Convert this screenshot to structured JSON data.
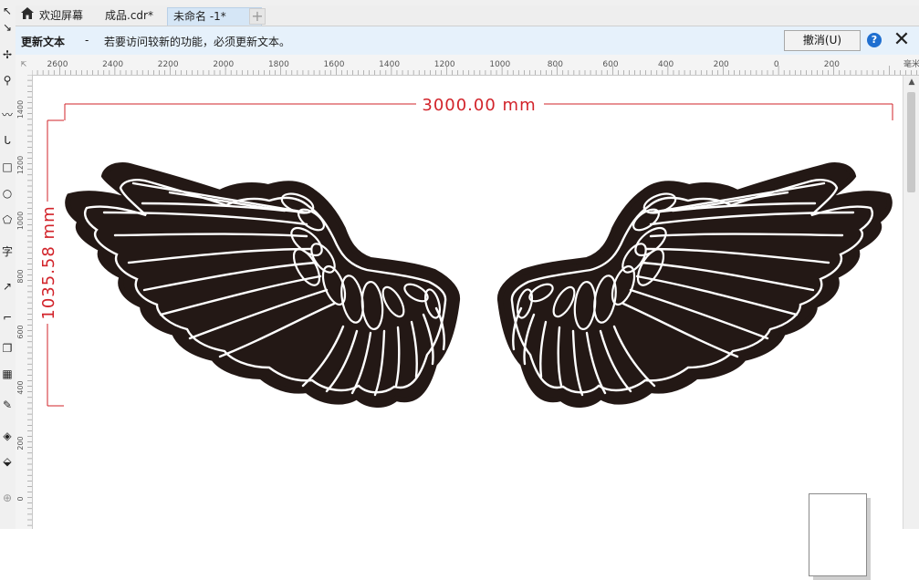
{
  "tabs": {
    "home_label": "欢迎屏幕",
    "file_label": "成品.cdr*",
    "active_label": "未命名 -1*",
    "add_label": "+"
  },
  "notification": {
    "title": "更新文本",
    "dash": "-",
    "message": "若要访问较新的功能，必须更新文本。",
    "cancel_label": "撤消(U)",
    "help_label": "?",
    "close_label": "✕"
  },
  "ruler": {
    "corner_label": "⇱",
    "unit": "毫米",
    "h_ticks": [
      "2600",
      "2400",
      "2200",
      "2000",
      "1800",
      "1600",
      "1400",
      "1200",
      "1000",
      "800",
      "600",
      "400",
      "200",
      "0",
      "200"
    ],
    "v_ticks": [
      "1400",
      "1200",
      "1000",
      "800",
      "600",
      "400",
      "200",
      "0"
    ]
  },
  "dimensions": {
    "width_label": "3000.00 mm",
    "height_label": "1035.58 mm",
    "color": "#d2232a"
  },
  "toolbox": {
    "icons": [
      "pick-tool-icon",
      "shape-tool-icon",
      "crop-tool-icon",
      "zoom-tool-icon",
      "freehand-tool-icon",
      "artistic-media-icon",
      "rectangle-tool-icon",
      "ellipse-tool-icon",
      "polygon-tool-icon",
      "text-tool-icon",
      "parallel-dimension-icon",
      "connector-tool-icon",
      "drop-shadow-icon",
      "transparency-icon",
      "eyedropper-icon",
      "interactive-fill-icon",
      "smart-fill-icon",
      "add-tool-icon"
    ],
    "text_tool_label": "字"
  },
  "colors": {
    "accent": "#1f6fd0",
    "notify_bg": "#e6f1fb",
    "wing_fill": "#231815"
  }
}
